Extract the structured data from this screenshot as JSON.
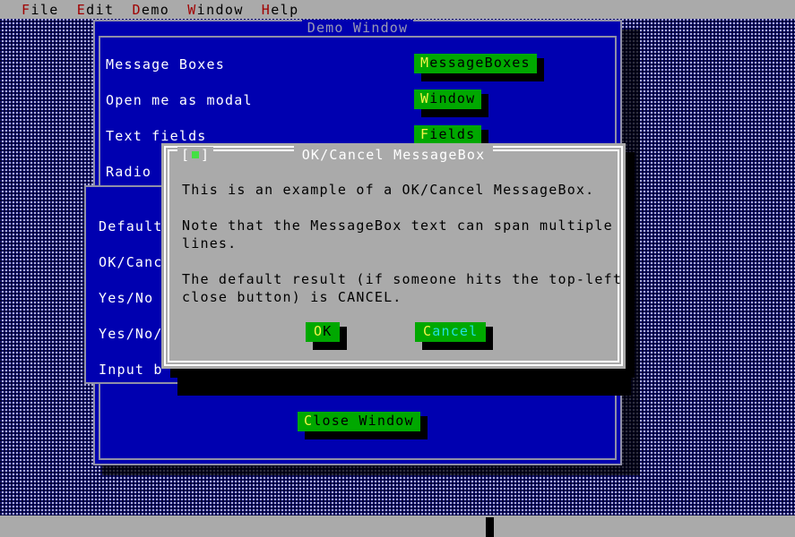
{
  "menubar": {
    "items": [
      {
        "hot": "F",
        "rest": "ile",
        "name": "menu-file"
      },
      {
        "hot": "E",
        "rest": "dit",
        "name": "menu-edit"
      },
      {
        "hot": "D",
        "rest": "emo",
        "name": "menu-demo"
      },
      {
        "hot": "W",
        "rest": "indow",
        "name": "menu-window"
      },
      {
        "hot": "H",
        "rest": "elp",
        "name": "menu-help"
      }
    ]
  },
  "demo_window": {
    "title": "Demo Window",
    "rows": [
      {
        "label": "Message Boxes",
        "button_hot": "M",
        "button_rest": "essageBoxes"
      },
      {
        "label": "Open me as modal",
        "button_hot": "W",
        "button_rest": "indow"
      },
      {
        "label": "Text fields",
        "button_hot": "F",
        "button_rest": "ields"
      },
      {
        "label": "Radio",
        "button_hot": "",
        "button_rest": ""
      }
    ],
    "close_button": {
      "hot": "C",
      "rest": "lose Window"
    }
  },
  "messagebox_window": {
    "labels": [
      "Default",
      "OK/Canc",
      "Yes/No",
      "Yes/No/",
      "Input b"
    ]
  },
  "dialog": {
    "title": "OK/Cancel MessageBox",
    "close_glyph_left": "[",
    "close_glyph_right": "]",
    "body_lines": [
      "This is an example of a OK/Cancel MessageBox.",
      "",
      "Note that the MessageBox text can span multiple",
      "lines.",
      "",
      "The default result (if someone hits the top-left",
      "close button) is CANCEL."
    ],
    "ok_button": {
      "hot": "O",
      "rest": "K"
    },
    "cancel_button": {
      "hot": "C",
      "rest": "ancel"
    }
  },
  "colors": {
    "desktop_light": "#a9a9d6",
    "desktop_dark": "#1a1a7a",
    "window_blue": "#0000b0",
    "dialog_gray": "#aaaaaa",
    "button_green": "#00a800",
    "hotkey_yellow": "#f4f448",
    "focus_cyan": "#22e0e0",
    "menu_hot_red": "#a00000",
    "frame_gray": "#8f8fa8"
  }
}
